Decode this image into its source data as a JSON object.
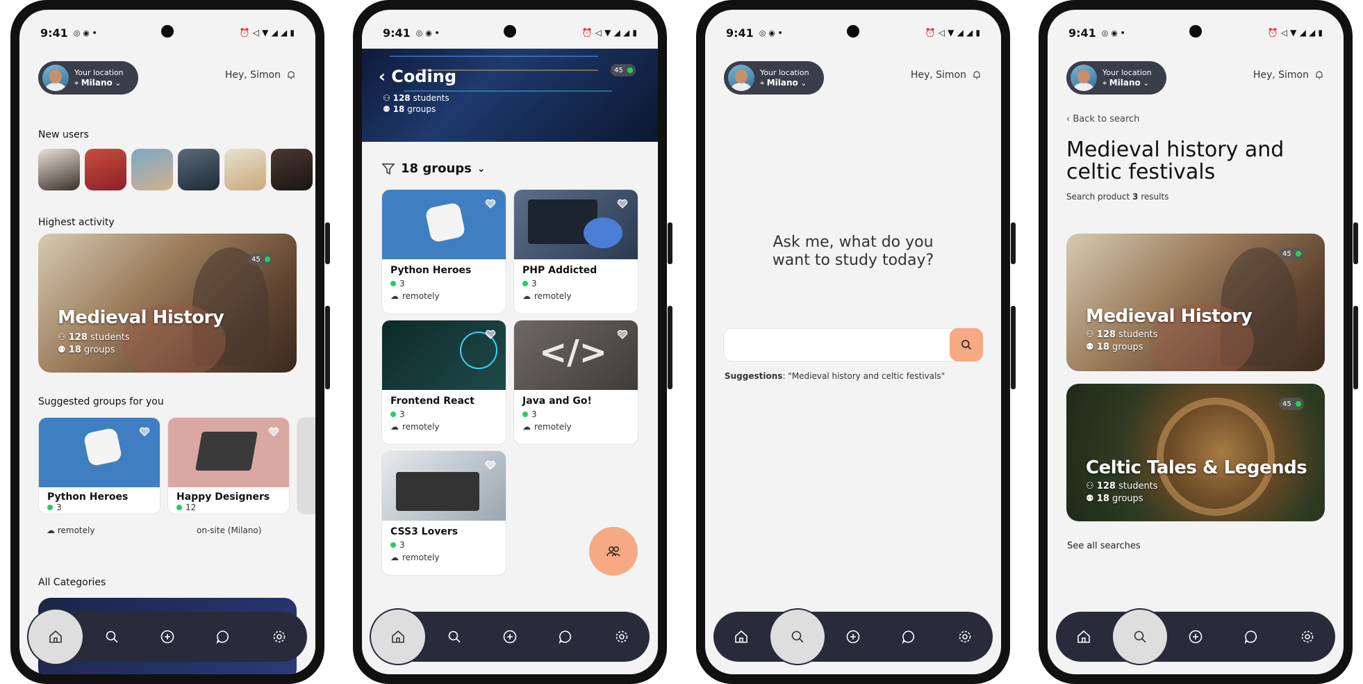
{
  "status": {
    "time": "9:41"
  },
  "header": {
    "location_label": "Your location",
    "location_value": "Milano",
    "greeting": "Hey, Simon"
  },
  "colors": {
    "accent": "#f6a983",
    "nav": "#292a3a",
    "online": "#22d15a"
  },
  "screen1": {
    "new_users_title": "New users",
    "highest_activity_title": "Highest activity",
    "hero": {
      "title": "Medieval History",
      "students": "128",
      "students_label": "students",
      "groups": "18",
      "groups_label": "groups",
      "badge": "45"
    },
    "suggested_title": "Suggested groups for you",
    "suggested": [
      {
        "title": "Python Heroes",
        "count": "3",
        "mode": "remotely"
      },
      {
        "title": "Happy Designers",
        "count": "12",
        "mode": "on-site (Milano)"
      }
    ],
    "all_categories_title": "All Categories"
  },
  "screen2": {
    "title": "Coding",
    "students": "128",
    "students_label": "students",
    "groups": "18",
    "groups_label": "groups",
    "badge": "45",
    "filter_label": "18 groups",
    "cards": [
      {
        "title": "Python Heroes",
        "count": "3",
        "mode": "remotely"
      },
      {
        "title": "PHP Addicted",
        "count": "3",
        "mode": "remotely"
      },
      {
        "title": "Frontend React",
        "count": "3",
        "mode": "remotely"
      },
      {
        "title": "Java and Go!",
        "count": "3",
        "mode": "remotely"
      },
      {
        "title": "CSS3 Lovers",
        "count": "3",
        "mode": "remotely"
      }
    ]
  },
  "screen3": {
    "prompt": "Ask me, what do you want to study today?",
    "search_placeholder": "",
    "suggestions_label": "Suggestions",
    "suggestion": ": \"Medieval history and celtic festivals\""
  },
  "screen4": {
    "back_label": "Back to search",
    "title": "Medieval history and celtic festivals",
    "results_prefix": "Search product",
    "results_count": "3",
    "results_suffix": "results",
    "results": [
      {
        "title": "Medieval History",
        "students": "128",
        "groups": "18",
        "badge": "45"
      },
      {
        "title": "Celtic Tales & Legends",
        "students": "128",
        "groups": "18",
        "badge": "45"
      }
    ],
    "students_label": "students",
    "groups_label": "groups",
    "see_all": "See all searches"
  }
}
